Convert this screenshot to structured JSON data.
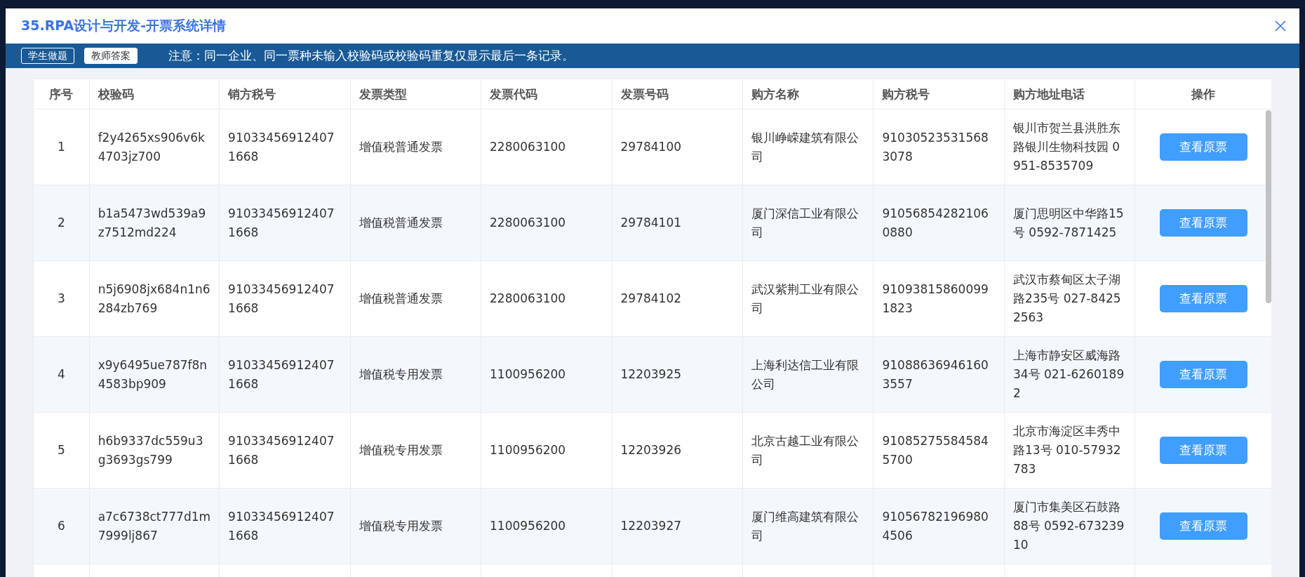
{
  "dialog": {
    "title": "35.RPA设计与开发-开票系统详情"
  },
  "toolbar": {
    "tabs": [
      {
        "label": "学生做题",
        "selected": false
      },
      {
        "label": "教师答案",
        "selected": true
      }
    ],
    "notice": "注意：同一企业、同一票种未输入校验码或校验码重复仅显示最后一条记录。"
  },
  "table": {
    "columns": [
      "序号",
      "校验码",
      "销方税号",
      "发票类型",
      "发票代码",
      "发票号码",
      "购方名称",
      "购方税号",
      "购方地址电话",
      "操作"
    ],
    "rows": [
      {
        "cells": [
          "1",
          "f2y4265xs906v6k4703jz700",
          "910334569124071668",
          "增值税普通发票",
          "2280063100",
          "29784100",
          "银川峥嵘建筑有限公司",
          "910305235315683078",
          "银川市贺兰县洪胜东路银川生物科技园 0951-8535709"
        ],
        "action": "查看原票"
      },
      {
        "cells": [
          "2",
          "b1a5473wd539a9z7512md224",
          "910334569124071668",
          "增值税普通发票",
          "2280063100",
          "29784101",
          "厦门深信工业有限公司",
          "910568542821060880",
          "厦门思明区中华路15号 0592-7871425"
        ],
        "action": "查看原票"
      },
      {
        "cells": [
          "3",
          "n5j6908jx684n1n6284zb769",
          "910334569124071668",
          "增值税普通发票",
          "2280063100",
          "29784102",
          "武汉紫荆工业有限公司",
          "910938158600991823",
          "武汉市蔡甸区太子湖路235号 027-84252563"
        ],
        "action": "查看原票"
      },
      {
        "cells": [
          "4",
          "x9y6495ue787f8n4583bp909",
          "910334569124071668",
          "增值税专用发票",
          "1100956200",
          "12203925",
          "上海利达信工业有限公司",
          "910886369461603557",
          "上海市静安区威海路34号 021-62601892"
        ],
        "action": "查看原票"
      },
      {
        "cells": [
          "5",
          "h6b9337dc559u3g3693gs799",
          "910334569124071668",
          "增值税专用发票",
          "1100956200",
          "12203926",
          "北京古越工业有限公司",
          "910852755845845700",
          "北京市海淀区丰秀中路13号 010-57932783"
        ],
        "action": "查看原票"
      },
      {
        "cells": [
          "6",
          "a7c6738ct777d1m7999lj867",
          "910334569124071668",
          "增值税专用发票",
          "1100956200",
          "12203927",
          "厦门维高建筑有限公司",
          "910567821969804506",
          "厦门市集美区石鼓路88号 0592-67323910"
        ],
        "action": "查看原票"
      }
    ]
  }
}
